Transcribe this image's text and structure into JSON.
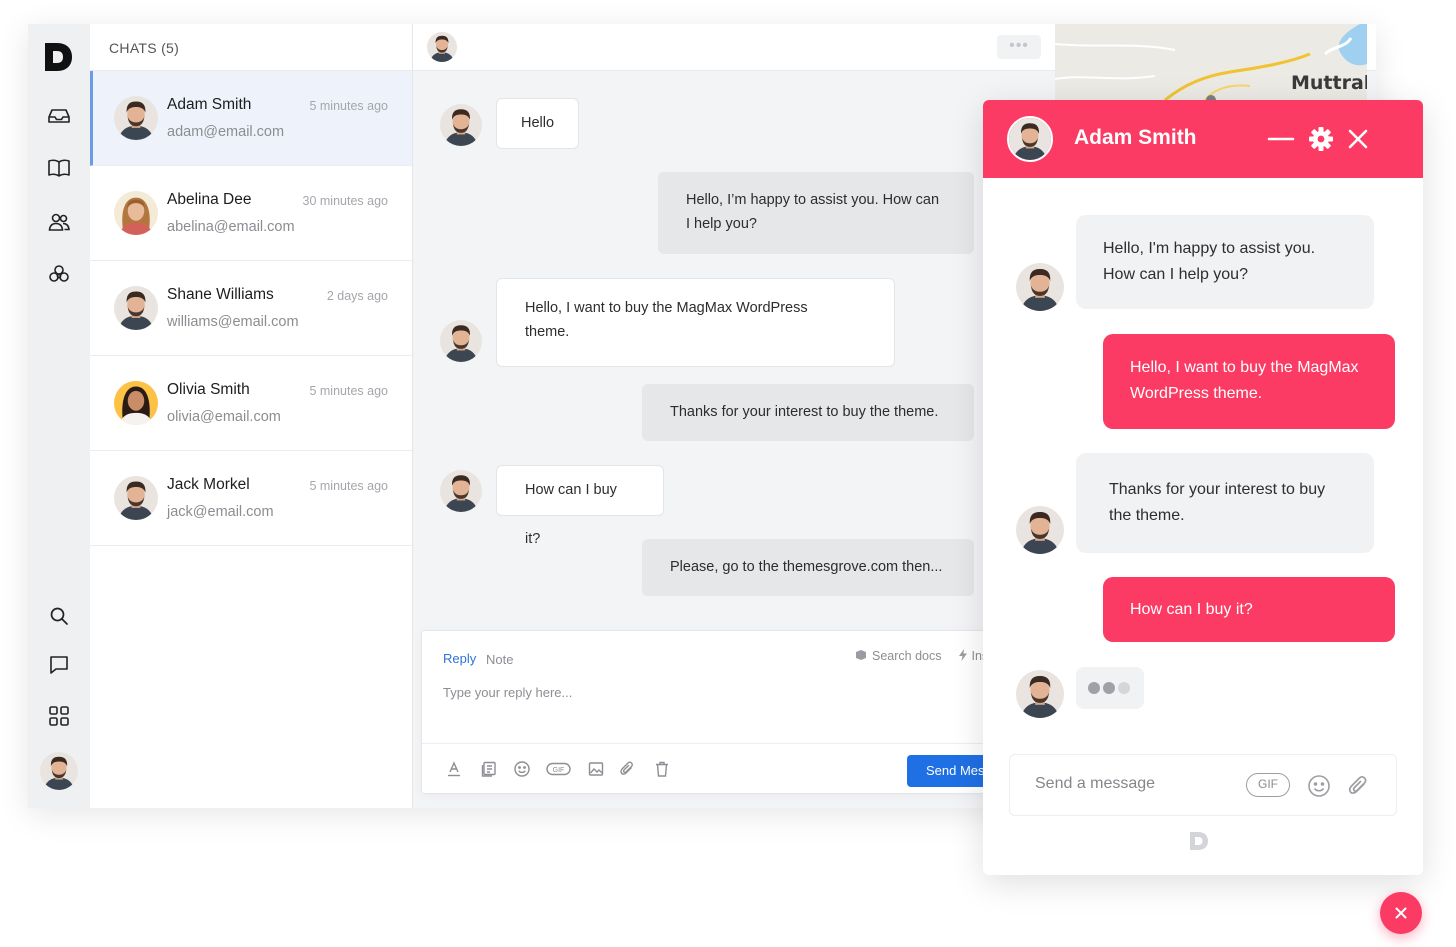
{
  "sidebar": {
    "nav_icons": [
      "inbox-icon",
      "book-icon",
      "users-icon",
      "integrations-icon"
    ],
    "bottom_icons": [
      "search-icon",
      "chat-icon",
      "apps-icon"
    ]
  },
  "chat_list": {
    "title": "CHATS (5)",
    "items": [
      {
        "name": "Adam Smith",
        "email": "adam@email.com",
        "time": "5 minutes ago"
      },
      {
        "name": "Abelina Dee",
        "email": "abelina@email.com",
        "time": "30 minutes ago"
      },
      {
        "name": "Shane Williams",
        "email": "williams@email.com",
        "time": "2 days ago"
      },
      {
        "name": "Olivia Smith",
        "email": "olivia@email.com",
        "time": "5 minutes ago"
      },
      {
        "name": "Jack Morkel",
        "email": "jack@email.com",
        "time": "5 minutes ago"
      }
    ]
  },
  "conversation": {
    "more_label": "•••",
    "messages": [
      {
        "from": "customer",
        "text": "Hello"
      },
      {
        "from": "agent",
        "line1": "Hello, I’m happy to assist you. How can",
        "line2": "I help you?"
      },
      {
        "from": "customer",
        "line1": "Hello, I want to buy the MagMax WordPress",
        "line2": "theme."
      },
      {
        "from": "agent",
        "text": "Thanks for your interest to buy the theme."
      },
      {
        "from": "customer",
        "text": "How can I buy it?"
      },
      {
        "from": "agent",
        "text": "Please, go to the themesgrove.com then..."
      }
    ]
  },
  "composer": {
    "tab_reply": "Reply",
    "tab_note": "Note",
    "search_docs": "Search docs",
    "insert_label": "Ins",
    "placeholder": "Type your reply here...",
    "send_label": "Send Mes",
    "gif_label": "GIF"
  },
  "map": {
    "city": "Muttrah"
  },
  "widget": {
    "title": "Adam Smith",
    "messages": [
      {
        "from": "agent",
        "line1": "Hello, I'm happy to assist you.",
        "line2": "How can I help you?"
      },
      {
        "from": "customer",
        "line1": "Hello, I want to buy the MagMax",
        "line2": "WordPress theme."
      },
      {
        "from": "agent",
        "line1": "Thanks for your interest to buy",
        "line2": "the theme."
      },
      {
        "from": "customer",
        "text": "How can I buy it?"
      }
    ],
    "input_placeholder": "Send a message",
    "gif_label": "GIF"
  },
  "colors": {
    "accent": "#fb3b63",
    "primary_blue": "#1f6fe5",
    "active_row": "#eef3fb",
    "active_border": "#6c9be6"
  }
}
